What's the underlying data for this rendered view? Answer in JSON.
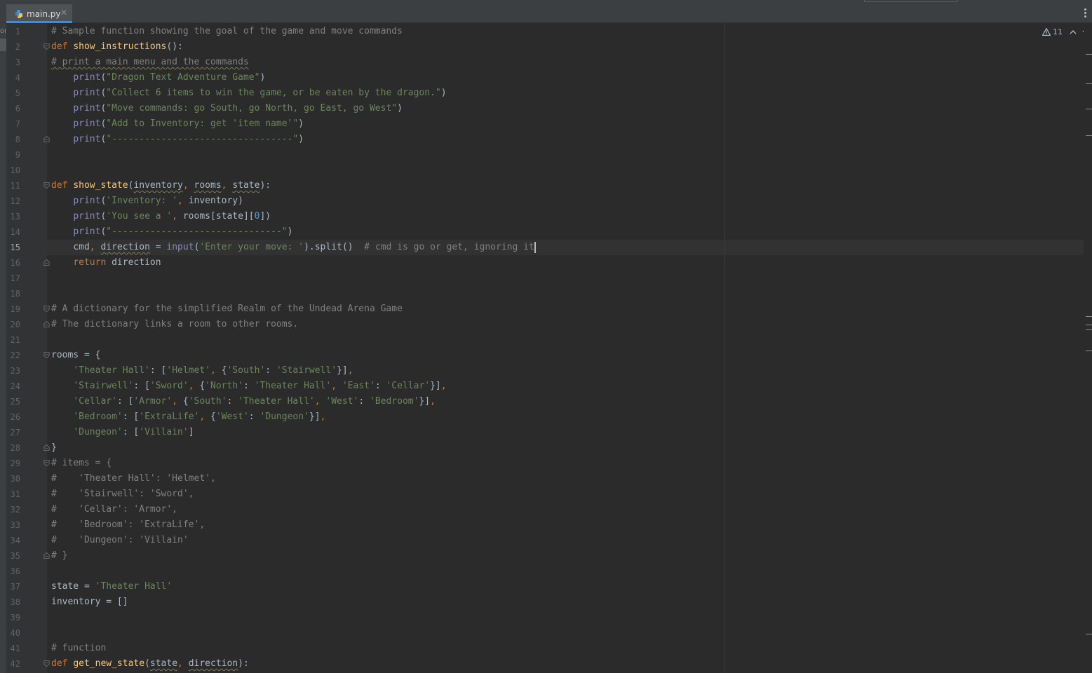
{
  "editor": {
    "tab": {
      "label": "main.py",
      "close": "✕"
    },
    "left_panel_fragment": "or",
    "inspection": {
      "warning_count": "11"
    },
    "current_line": 15,
    "lines": [
      [
        [
          "cm",
          "# Sample function showing the goal of the game and move commands"
        ]
      ],
      [
        [
          "kw",
          "def "
        ],
        [
          "fn",
          "show_instructions"
        ],
        [
          "p",
          "():"
        ]
      ],
      [
        [
          "cmw",
          "# print a main menu and the commands"
        ]
      ],
      [
        [
          "p",
          "    "
        ],
        [
          "bi",
          "print"
        ],
        [
          "p",
          "("
        ],
        [
          "str",
          "\"Dragon Text Adventure Game\""
        ],
        [
          "p",
          ")"
        ]
      ],
      [
        [
          "p",
          "    "
        ],
        [
          "bi",
          "print"
        ],
        [
          "p",
          "("
        ],
        [
          "str",
          "\"Collect 6 items to win the game, or be eaten by the dragon.\""
        ],
        [
          "p",
          ")"
        ]
      ],
      [
        [
          "p",
          "    "
        ],
        [
          "bi",
          "print"
        ],
        [
          "p",
          "("
        ],
        [
          "str",
          "\"Move commands: go South, go North, go East, go West\""
        ],
        [
          "p",
          ")"
        ]
      ],
      [
        [
          "p",
          "    "
        ],
        [
          "bi",
          "print"
        ],
        [
          "p",
          "("
        ],
        [
          "str",
          "\"Add to Inventory: get 'item name'\""
        ],
        [
          "p",
          ")"
        ]
      ],
      [
        [
          "p",
          "    "
        ],
        [
          "bi",
          "print"
        ],
        [
          "p",
          "("
        ],
        [
          "str",
          "\"---------------------------------\""
        ],
        [
          "p",
          ")"
        ]
      ],
      [],
      [],
      [
        [
          "kw",
          "def "
        ],
        [
          "fn",
          "show_state"
        ],
        [
          "p",
          "("
        ],
        [
          "pw",
          "inventory"
        ],
        [
          "kw",
          ", "
        ],
        [
          "pw",
          "rooms"
        ],
        [
          "kw",
          ", "
        ],
        [
          "pw",
          "state"
        ],
        [
          "p",
          "):"
        ]
      ],
      [
        [
          "p",
          "    "
        ],
        [
          "bi",
          "print"
        ],
        [
          "p",
          "("
        ],
        [
          "str",
          "'Inventory: '"
        ],
        [
          "kw",
          ", "
        ],
        [
          "p",
          "inventory)"
        ]
      ],
      [
        [
          "p",
          "    "
        ],
        [
          "bi",
          "print"
        ],
        [
          "p",
          "("
        ],
        [
          "str",
          "'You see a '"
        ],
        [
          "kw",
          ", "
        ],
        [
          "p",
          "rooms[state]["
        ],
        [
          "num",
          "0"
        ],
        [
          "p",
          "])"
        ]
      ],
      [
        [
          "p",
          "    "
        ],
        [
          "bi",
          "print"
        ],
        [
          "p",
          "("
        ],
        [
          "str",
          "\"-------------------------------\""
        ],
        [
          "p",
          ")"
        ]
      ],
      [
        [
          "p",
          "    cmd"
        ],
        [
          "kw",
          ", "
        ],
        [
          "pw",
          "direction"
        ],
        [
          "p",
          " = "
        ],
        [
          "bi",
          "input"
        ],
        [
          "p",
          "("
        ],
        [
          "str",
          "'Enter your move: '"
        ],
        [
          "p",
          ").split()  "
        ],
        [
          "cm",
          "# cmd is go or get, ignoring it"
        ]
      ],
      [
        [
          "p",
          "    "
        ],
        [
          "kw",
          "return "
        ],
        [
          "p",
          "direction"
        ]
      ],
      [],
      [],
      [
        [
          "cm",
          "# A dictionary for the simplified Realm of the Undead Arena Game"
        ]
      ],
      [
        [
          "cm",
          "# The dictionary links a room to other rooms."
        ]
      ],
      [],
      [
        [
          "p",
          "rooms = {"
        ]
      ],
      [
        [
          "p",
          "    "
        ],
        [
          "str",
          "'Theater Hall'"
        ],
        [
          "p",
          ": ["
        ],
        [
          "str",
          "'Helmet'"
        ],
        [
          "kw",
          ", "
        ],
        [
          "p",
          "{"
        ],
        [
          "str",
          "'South'"
        ],
        [
          "p",
          ": "
        ],
        [
          "str",
          "'Stairwell'"
        ],
        [
          "p",
          "}]"
        ],
        [
          "kw",
          ","
        ]
      ],
      [
        [
          "p",
          "    "
        ],
        [
          "str",
          "'Stairwell'"
        ],
        [
          "p",
          ": ["
        ],
        [
          "str",
          "'Sword'"
        ],
        [
          "kw",
          ", "
        ],
        [
          "p",
          "{"
        ],
        [
          "str",
          "'North'"
        ],
        [
          "p",
          ": "
        ],
        [
          "str",
          "'Theater Hall'"
        ],
        [
          "kw",
          ", "
        ],
        [
          "str",
          "'East'"
        ],
        [
          "p",
          ": "
        ],
        [
          "str",
          "'Cellar'"
        ],
        [
          "p",
          "}]"
        ],
        [
          "kw",
          ","
        ]
      ],
      [
        [
          "p",
          "    "
        ],
        [
          "str",
          "'Cellar'"
        ],
        [
          "p",
          ": ["
        ],
        [
          "str",
          "'Armor'"
        ],
        [
          "kw",
          ", "
        ],
        [
          "p",
          "{"
        ],
        [
          "str",
          "'South'"
        ],
        [
          "p",
          ": "
        ],
        [
          "str",
          "'Theater Hall'"
        ],
        [
          "kw",
          ", "
        ],
        [
          "str",
          "'West'"
        ],
        [
          "p",
          ": "
        ],
        [
          "str",
          "'Bedroom'"
        ],
        [
          "p",
          "}]"
        ],
        [
          "kw",
          ","
        ]
      ],
      [
        [
          "p",
          "    "
        ],
        [
          "str",
          "'Bedroom'"
        ],
        [
          "p",
          ": ["
        ],
        [
          "str",
          "'ExtraLife'"
        ],
        [
          "kw",
          ", "
        ],
        [
          "p",
          "{"
        ],
        [
          "str",
          "'West'"
        ],
        [
          "p",
          ": "
        ],
        [
          "str",
          "'Dungeon'"
        ],
        [
          "p",
          "}]"
        ],
        [
          "kw",
          ","
        ]
      ],
      [
        [
          "p",
          "    "
        ],
        [
          "str",
          "'Dungeon'"
        ],
        [
          "p",
          ": ["
        ],
        [
          "str",
          "'Villain'"
        ],
        [
          "p",
          "]"
        ]
      ],
      [
        [
          "p",
          "}"
        ]
      ],
      [
        [
          "cm",
          "# items = {"
        ]
      ],
      [
        [
          "cm",
          "#    'Theater Hall': 'Helmet',"
        ]
      ],
      [
        [
          "cm",
          "#    'Stairwell': 'Sword',"
        ]
      ],
      [
        [
          "cm",
          "#    'Cellar': 'Armor',"
        ]
      ],
      [
        [
          "cm",
          "#    'Bedroom': 'ExtraLife',"
        ]
      ],
      [
        [
          "cm",
          "#    'Dungeon': 'Villain'"
        ]
      ],
      [
        [
          "cm",
          "# }"
        ]
      ],
      [],
      [
        [
          "p",
          "state = "
        ],
        [
          "str",
          "'Theater Hall'"
        ]
      ],
      [
        [
          "p",
          "inventory = []"
        ]
      ],
      [],
      [],
      [
        [
          "cm",
          "# function"
        ]
      ],
      [
        [
          "kw",
          "def "
        ],
        [
          "fn",
          "get_new_state"
        ],
        [
          "p",
          "("
        ],
        [
          "pw",
          "state"
        ],
        [
          "kw",
          ", "
        ],
        [
          "pw",
          "direction"
        ],
        [
          "p",
          "):"
        ]
      ]
    ],
    "fold_lines": [
      2,
      8,
      11,
      16,
      19,
      20,
      22,
      28,
      29,
      35,
      42
    ],
    "fold_open_lines": [
      2,
      11,
      19,
      22,
      29,
      42
    ],
    "colors": {
      "background": "#2b2b2b",
      "keyword": "#cc7832",
      "function": "#ffc66d",
      "string": "#6a8759",
      "comment": "#808080",
      "number": "#6897bb",
      "builtin": "#8888c6",
      "plain": "#a9b7c6",
      "tab_accent": "#4a88c7"
    }
  }
}
